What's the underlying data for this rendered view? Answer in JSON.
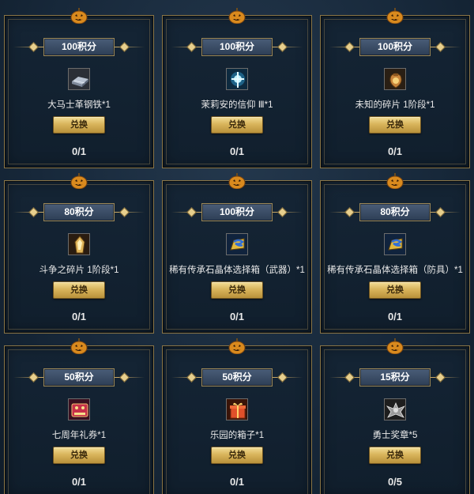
{
  "rewards": [
    {
      "points": "100积分",
      "icon": "steel-ingot-icon",
      "name": "大马士革钢铁*1",
      "button": "兑换",
      "count": "0/1"
    },
    {
      "points": "100积分",
      "icon": "blue-light-icon",
      "name": "茉莉安的信仰 Ⅲ*1",
      "button": "兑换",
      "count": "0/1"
    },
    {
      "points": "100积分",
      "icon": "fragment-bag-icon",
      "name": "未知的碎片 1阶段*1",
      "button": "兑换",
      "count": "0/1"
    },
    {
      "points": "80积分",
      "icon": "battle-fragment-icon",
      "name": "斗争之碎片 1阶段*1",
      "button": "兑换",
      "count": "0/1"
    },
    {
      "points": "100积分",
      "icon": "crystal-box-weapon-icon",
      "name": "稀有传承石晶体选择箱（武器）*1",
      "button": "兑换",
      "count": "0/1"
    },
    {
      "points": "80积分",
      "icon": "crystal-box-armor-icon",
      "name": "稀有传承石晶体选择箱（防具）*1",
      "button": "兑换",
      "count": "0/1"
    },
    {
      "points": "50积分",
      "icon": "coupon-icon",
      "name": "七周年礼券*1",
      "button": "兑换",
      "count": "0/1"
    },
    {
      "points": "50积分",
      "icon": "gift-box-icon",
      "name": "乐园的箱子*1",
      "button": "兑换",
      "count": "0/1"
    },
    {
      "points": "15积分",
      "icon": "medal-icon",
      "name": "勇士奖章*5",
      "button": "兑换",
      "count": "0/5"
    }
  ]
}
